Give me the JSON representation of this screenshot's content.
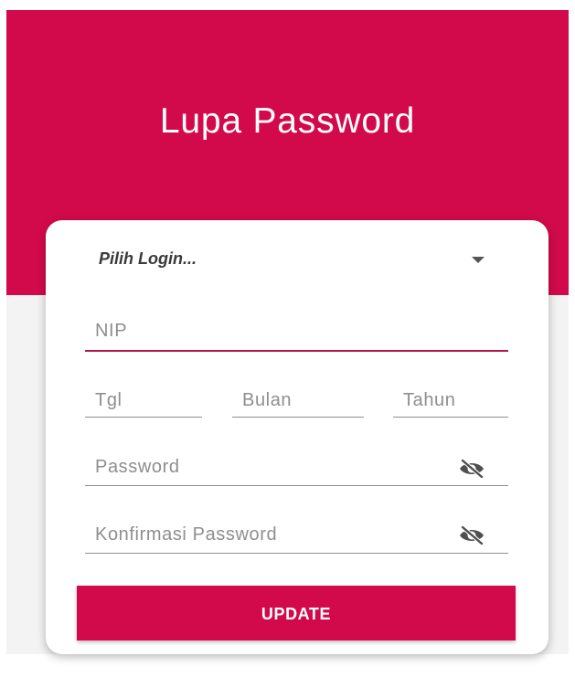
{
  "header": {
    "title": "Lupa Password"
  },
  "form": {
    "login_select": {
      "placeholder": "Pilih Login..."
    },
    "nip": {
      "placeholder": "NIP"
    },
    "birth": {
      "day_placeholder": "Tgl",
      "month_placeholder": "Bulan",
      "year_placeholder": "Tahun"
    },
    "password": {
      "placeholder": "Password"
    },
    "confirm_password": {
      "placeholder": "Konfirmasi Password"
    },
    "update_button": "UPDATE"
  },
  "colors": {
    "brand": "#d20a4b",
    "active_underline": "#b3164b",
    "background_bottom": "#f3f3f3"
  },
  "icons": {
    "password_toggle": "eye-off-icon",
    "dropdown": "caret-down-icon"
  }
}
